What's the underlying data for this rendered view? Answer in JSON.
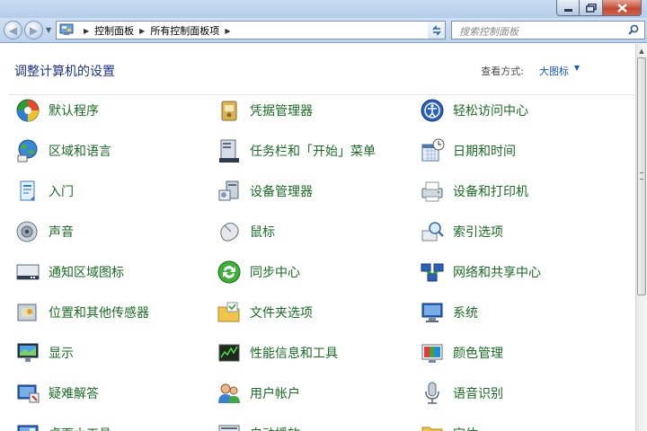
{
  "window": {
    "buttons": {
      "minimize": "minimize",
      "maximize": "maximize",
      "close": "close"
    }
  },
  "nav": {
    "breadcrumbs": [
      "控制面板",
      "所有控制面板项"
    ],
    "search_placeholder": "搜索控制面板"
  },
  "header": {
    "title": "调整计算机的设置",
    "view_by_label": "查看方式:",
    "view_by_value": "大图标"
  },
  "items": [
    {
      "label": "默认程序",
      "icon": "default-programs-icon"
    },
    {
      "label": "凭据管理器",
      "icon": "credential-manager-icon"
    },
    {
      "label": "轻松访问中心",
      "icon": "ease-of-access-icon"
    },
    {
      "label": "区域和语言",
      "icon": "region-language-icon"
    },
    {
      "label": "任务栏和「开始」菜单",
      "icon": "taskbar-start-icon"
    },
    {
      "label": "日期和时间",
      "icon": "date-time-icon"
    },
    {
      "label": "入门",
      "icon": "getting-started-icon"
    },
    {
      "label": "设备管理器",
      "icon": "device-manager-icon"
    },
    {
      "label": "设备和打印机",
      "icon": "devices-printers-icon"
    },
    {
      "label": "声音",
      "icon": "sound-icon"
    },
    {
      "label": "鼠标",
      "icon": "mouse-icon"
    },
    {
      "label": "索引选项",
      "icon": "indexing-options-icon"
    },
    {
      "label": "通知区域图标",
      "icon": "notification-area-icon"
    },
    {
      "label": "同步中心",
      "icon": "sync-center-icon"
    },
    {
      "label": "网络和共享中心",
      "icon": "network-sharing-icon"
    },
    {
      "label": "位置和其他传感器",
      "icon": "location-sensors-icon"
    },
    {
      "label": "文件夹选项",
      "icon": "folder-options-icon"
    },
    {
      "label": "系统",
      "icon": "system-icon"
    },
    {
      "label": "显示",
      "icon": "display-icon"
    },
    {
      "label": "性能信息和工具",
      "icon": "performance-icon"
    },
    {
      "label": "颜色管理",
      "icon": "color-management-icon"
    },
    {
      "label": "疑难解答",
      "icon": "troubleshooting-icon"
    },
    {
      "label": "用户帐户",
      "icon": "user-accounts-icon"
    },
    {
      "label": "语音识别",
      "icon": "speech-recognition-icon"
    },
    {
      "label": "桌面小工具",
      "icon": "desktop-gadgets-icon"
    },
    {
      "label": "自动播放",
      "icon": "autoplay-icon"
    },
    {
      "label": "字体",
      "icon": "fonts-icon"
    }
  ]
}
